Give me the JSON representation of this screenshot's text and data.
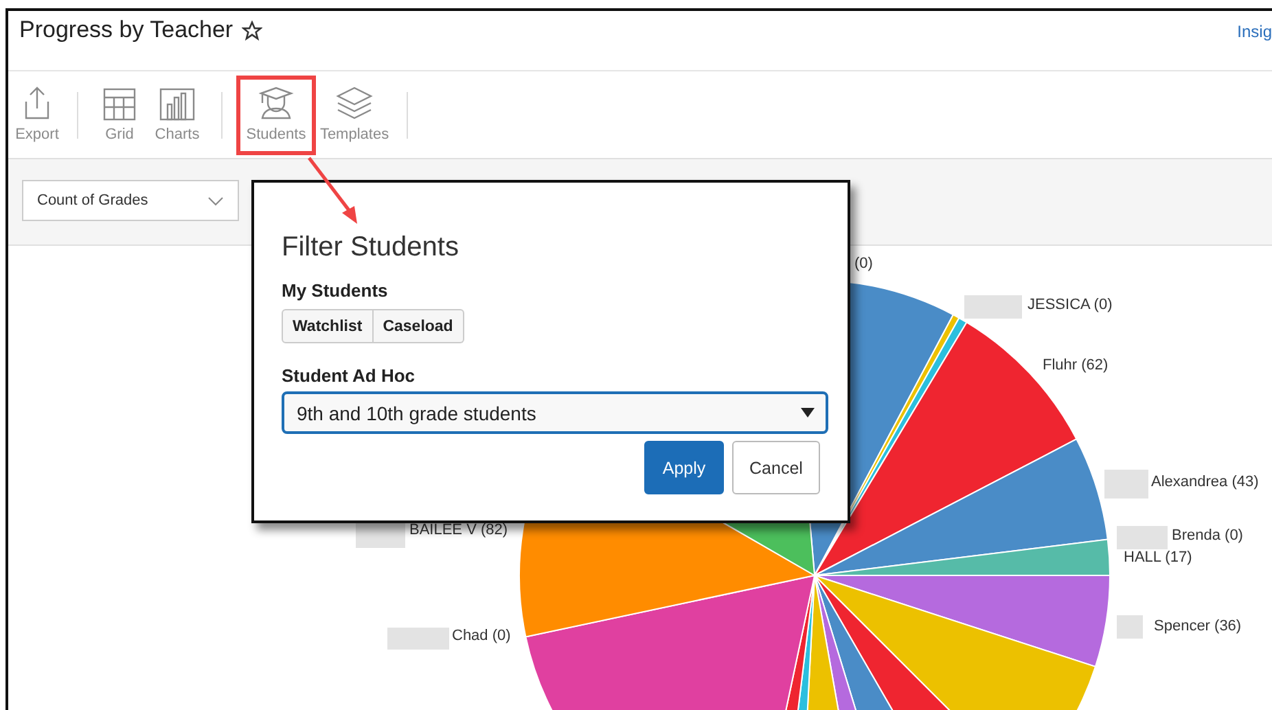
{
  "page": {
    "title": "Progress by Teacher",
    "favorite": false,
    "link": "Insig"
  },
  "toolbar": [
    {
      "kind": "export",
      "label": "Export",
      "highlighted": false
    },
    {
      "kind": "grid",
      "label": "Grid",
      "highlighted": false
    },
    {
      "kind": "charts",
      "label": "Charts",
      "highlighted": false
    },
    {
      "kind": "students",
      "label": "Students",
      "highlighted": true
    },
    {
      "kind": "templates",
      "label": "Templates",
      "highlighted": false
    }
  ],
  "measure_select": {
    "value": "Count of Grades"
  },
  "chart_labels": [
    {
      "text": "(0)"
    },
    {
      "text": "JESSICA (0)"
    },
    {
      "text": "Fluhr (62)"
    },
    {
      "text": "Alexandrea (43)"
    },
    {
      "text": "Brenda (0)"
    },
    {
      "text": "HALL (17)"
    },
    {
      "text": "Spencer (36)"
    },
    {
      "text": "BAILEE V (82)"
    },
    {
      "text": "Chad (0)"
    }
  ],
  "dialog": {
    "title": "Filter Students",
    "my_students_label": "My Students",
    "toggles": [
      {
        "label": "Watchlist",
        "selected": false
      },
      {
        "label": "Caseload",
        "selected": false
      }
    ],
    "adhoc_label": "Student Ad Hoc",
    "adhoc_value": "9th and 10th grade students",
    "buttons": [
      {
        "kind": "primary",
        "label": "Apply"
      },
      {
        "kind": "secondary",
        "label": "Cancel"
      }
    ]
  }
}
